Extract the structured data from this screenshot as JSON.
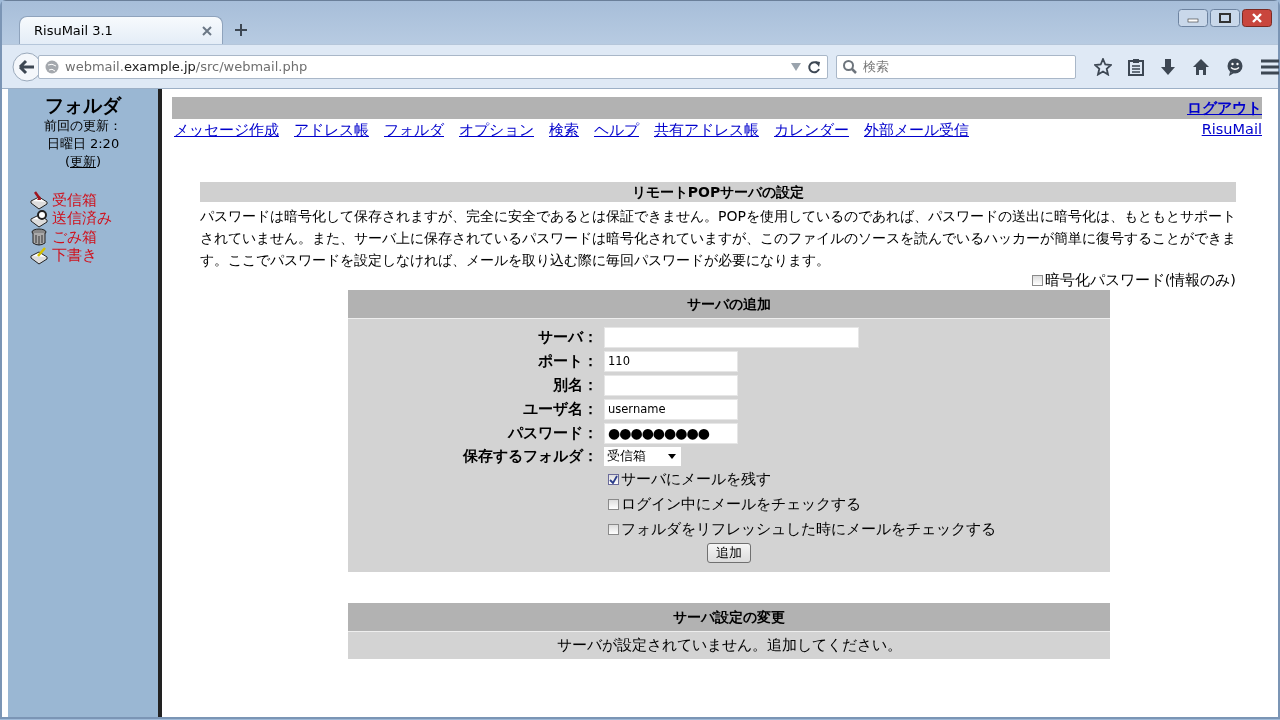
{
  "browser": {
    "tab_title": "RisuMail 3.1",
    "url": {
      "prefix": "webmail.",
      "host": "example.jp",
      "path": "/src/webmail.php"
    },
    "search_placeholder": "検索"
  },
  "sidebar": {
    "title": "フォルダ",
    "updated_label": "前回の更新：",
    "updated_time": "日曜日 2:20",
    "refresh_open": "(",
    "refresh_link": "更新",
    "refresh_close": ")",
    "folders": [
      {
        "name": "受信箱",
        "kind": "inbox"
      },
      {
        "name": "送信済み",
        "kind": "sent"
      },
      {
        "name": "ごみ箱",
        "kind": "trash"
      },
      {
        "name": "下書き",
        "kind": "drafts"
      }
    ]
  },
  "topbar": {
    "logout": "ログアウト",
    "brand": "RisuMail",
    "menu": [
      "メッセージ作成",
      "アドレス帳",
      "フォルダ",
      "オプション",
      "検索",
      "ヘルプ",
      "共有アドレス帳",
      "カレンダー",
      "外部メール受信"
    ]
  },
  "settings": {
    "title": "リモートPOPサーバの設定",
    "notice": "パスワードは暗号化して保存されますが、完全に安全であるとは保証できません。POPを使用しているのであれば、パスワードの送出に暗号化は、もともとサポートされていません。また、サーバ上に保存されているパスワードは暗号化されていますが、このファイルのソースを読んでいるハッカーが簡単に復号することができます。ここでパスワードを設定しなければ、メールを取り込む際に毎回パスワードが必要になります。",
    "encrypt_option": {
      "label": "暗号化パスワード(情報のみ)",
      "checked": false
    }
  },
  "add_server": {
    "title": "サーバの追加",
    "fields": [
      {
        "label": "サーバ：",
        "kind": "wide"
      },
      {
        "label": "ポート：",
        "kind": "text",
        "value": "110"
      },
      {
        "label": "別名：",
        "kind": "text"
      },
      {
        "label": "ユーザ名：",
        "kind": "text",
        "value": "username"
      },
      {
        "label": "パスワード：",
        "kind": "password",
        "value": "●●●●●●●●●"
      },
      {
        "label": "保存するフォルダ：",
        "kind": "select",
        "value": "受信箱"
      }
    ],
    "options": [
      {
        "label": "サーバにメールを残す",
        "checked": true
      },
      {
        "label": "ログイン中にメールをチェックする",
        "checked": false
      },
      {
        "label": "フォルダをリフレッシュした時にメールをチェックする",
        "checked": false
      }
    ],
    "button": "追加"
  },
  "change_server": {
    "title": "サーバ設定の変更",
    "message": "サーバが設定されていません。追加してください。"
  }
}
